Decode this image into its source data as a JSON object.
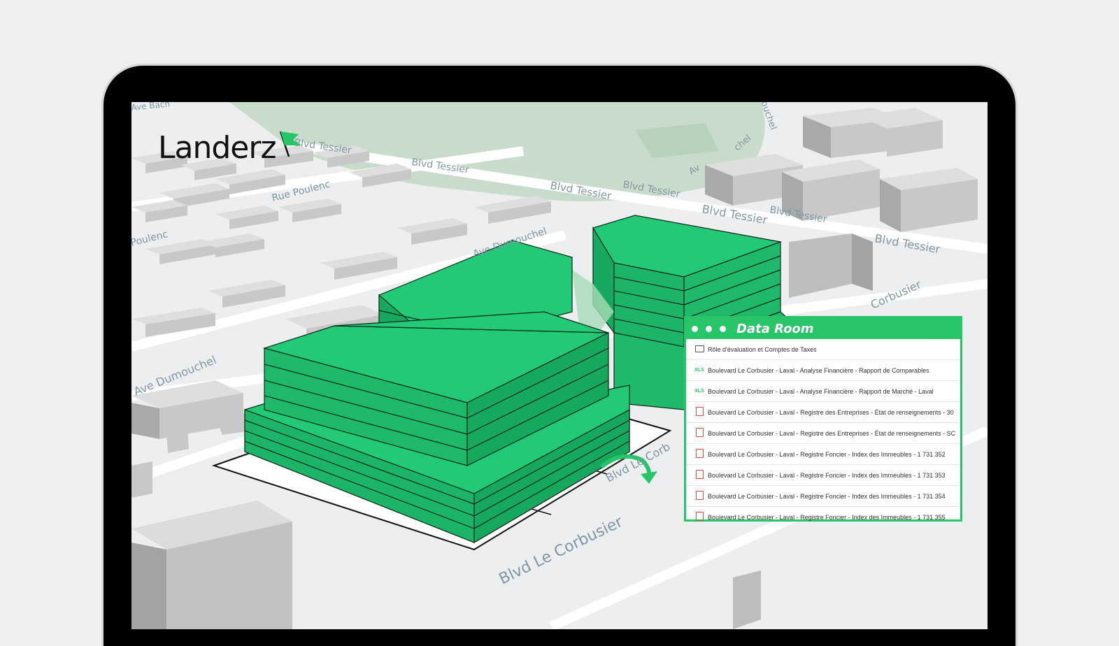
{
  "brand": {
    "name": "Landerz",
    "accent": "#27c468"
  },
  "streets": {
    "ave_bach": "Ave Bach",
    "tessier_1": "Blvd Tessier",
    "tessier_2": "Blvd Tessier",
    "tessier_3": "Blvd Tessier",
    "tessier_4": "Blvd Tessier",
    "tessier_5": "Blvd Tessier",
    "tessier_6": "Blvd Tessier",
    "tessier_7": "Blvd Tessier",
    "poulenc_1": "Rue Poulenc",
    "poulenc_2": "Poulenc",
    "dumouchel_1": "Ave Dumouchel",
    "dumouchel_2": "Ave Dumouchel",
    "corbusier_main": "Blvd Le Corbusier",
    "corbusier_2": "Blvd Le Corb",
    "corbusier_3": "Corbusier",
    "ouchel": "ouchel",
    "chel": "chel",
    "ave_av": "Av",
    "sier": "sier"
  },
  "data_room": {
    "title": "Data Room",
    "items": [
      {
        "icon": "folder-icon",
        "label": "Rôle d'évaluation et Comptes de Taxes"
      },
      {
        "icon": "xls-icon",
        "label": "Boulevard Le Corbusier - Laval - Analyse Financière - Rapport de Comparables"
      },
      {
        "icon": "xls-icon",
        "label": "Boulevard Le Corbusier - Laval - Analyse Financière - Rapport de Marché - Laval"
      },
      {
        "icon": "pdf-icon",
        "label": "Boulevard Le Corbusier - Laval - Registre des Entreprises - État de renseignements - 30"
      },
      {
        "icon": "pdf-icon",
        "label": "Boulevard Le Corbusier - Laval - Registre des Entreprises - État de renseignements - SC"
      },
      {
        "icon": "pdf-icon",
        "label": "Boulevard Le Corbusier - Laval - Registre Foncier - Index des Immeubles - 1 731 352"
      },
      {
        "icon": "pdf-icon",
        "label": "Boulevard Le Corbusier - Laval - Registre Foncier - Index des Immeubles - 1 731 353"
      },
      {
        "icon": "pdf-icon",
        "label": "Boulevard Le Corbusier - Laval - Registre Foncier - Index des Immeubles - 1 731 354"
      },
      {
        "icon": "pdf-icon",
        "label": "Boulevard Le Corbusier - Laval - Registre Foncier - Index des Immeubles - 1 731 355"
      }
    ],
    "icon_labels": {
      "xls": "XLS",
      "pdf": "PDF"
    }
  },
  "colors": {
    "building_green": "#22c976",
    "building_gray": "#c4c4c4",
    "park": "#c9dccb",
    "map_bg": "#eceef0"
  }
}
